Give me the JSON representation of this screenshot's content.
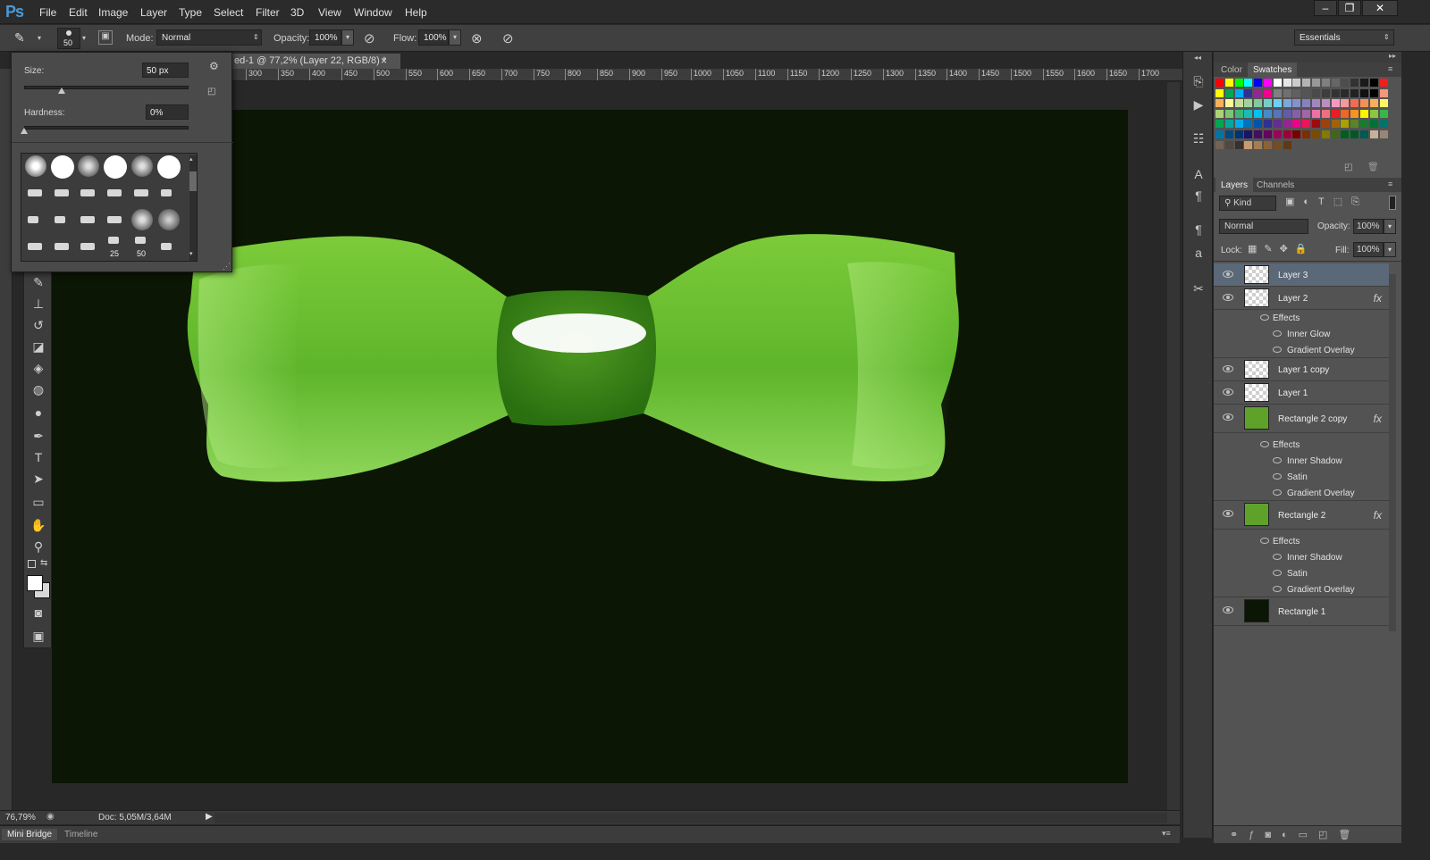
{
  "app": {
    "logo": "Ps"
  },
  "menu": [
    "File",
    "Edit",
    "Image",
    "Layer",
    "Type",
    "Select",
    "Filter",
    "3D",
    "View",
    "Window",
    "Help"
  ],
  "window_controls": {
    "minimize": "–",
    "restore": "❐",
    "close": "✕"
  },
  "options": {
    "brush_size": "50",
    "mode_label": "Mode:",
    "mode_value": "Normal",
    "opacity_label": "Opacity:",
    "opacity_value": "100%",
    "flow_label": "Flow:",
    "flow_value": "100%",
    "workspace": "Essentials"
  },
  "brush_popup": {
    "size_label": "Size:",
    "size_value": "50 px",
    "size_fraction": 0.23,
    "hardness_label": "Hardness:",
    "hardness_value": "0%",
    "hardness_fraction": 0.0,
    "preset_numbers": [
      "25",
      "50"
    ]
  },
  "document": {
    "tab_title": "ed-1 @ 77,2% (Layer 22, RGB/8) *",
    "tab_close": "×",
    "ruler_ticks": [
      "300",
      "350",
      "400",
      "450",
      "500",
      "550",
      "600",
      "650",
      "700",
      "750",
      "800",
      "850",
      "900",
      "950",
      "1000",
      "1050",
      "1100",
      "1150",
      "1200",
      "1250",
      "1300",
      "1350",
      "1400",
      "1450",
      "1500",
      "1550",
      "1600",
      "1650",
      "1700"
    ],
    "canvas_color": "#0b1604"
  },
  "colors": {
    "bow_green": "#5fb82a",
    "bow_light": "#9ade4a",
    "bow_dark": "#2f7a12",
    "accent": "#4a9ad8"
  },
  "swatches_panel": {
    "tab_color": "Color",
    "tab_swatches": "Swatches"
  },
  "layers_panel": {
    "tab_layers": "Layers",
    "tab_channels": "Channels",
    "kind_filter": "Kind",
    "blend_mode": "Normal",
    "opacity_label": "Opacity:",
    "opacity_value": "100%",
    "lock_label": "Lock:",
    "fill_label": "Fill:",
    "fill_value": "100%",
    "layers": [
      {
        "name": "Layer 3",
        "selected": true,
        "fx": ""
      },
      {
        "name": "Layer 2",
        "selected": false,
        "fx": "fx",
        "effects": [
          "Effects",
          "Inner Glow",
          "Gradient Overlay"
        ]
      },
      {
        "name": "Layer 1 copy",
        "selected": false,
        "fx": ""
      },
      {
        "name": "Layer 1",
        "selected": false,
        "fx": ""
      },
      {
        "name": "Rectangle 2 copy",
        "selected": false,
        "fx": "fx",
        "effects": [
          "Effects",
          "Inner Shadow",
          "Satin",
          "Gradient Overlay"
        ]
      },
      {
        "name": "Rectangle 2",
        "selected": false,
        "fx": "fx",
        "effects": [
          "Effects",
          "Inner Shadow",
          "Satin",
          "Gradient Overlay"
        ]
      },
      {
        "name": "Rectangle 1",
        "selected": false,
        "fx": ""
      }
    ]
  },
  "status": {
    "zoom": "76,79%",
    "doc_size": "Doc: 5,05M/3,64M"
  },
  "bottom_tabs": [
    "Mini Bridge",
    "Timeline"
  ]
}
